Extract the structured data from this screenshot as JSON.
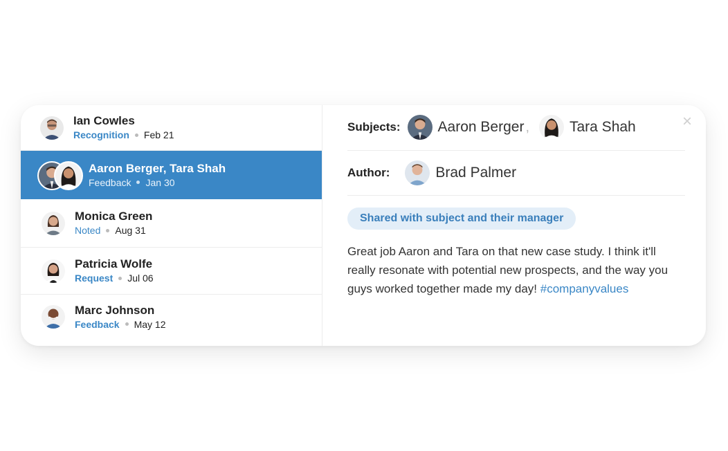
{
  "feed": {
    "items": [
      {
        "name": "Ian Cowles",
        "type": "Recognition",
        "date": "Feb 21"
      },
      {
        "name": "Aaron Berger, Tara Shah",
        "type": "Feedback",
        "date": "Jan 30"
      },
      {
        "name": "Monica Green",
        "type": "Noted",
        "date": "Aug 31"
      },
      {
        "name": "Patricia Wolfe",
        "type": "Request",
        "date": "Jul 06"
      },
      {
        "name": "Marc Johnson",
        "type": "Feedback",
        "date": "May 12"
      }
    ]
  },
  "detail": {
    "subjects_label": "Subjects:",
    "subjects": [
      "Aaron Berger",
      "Tara Shah"
    ],
    "subjects_separator": ",",
    "author_label": "Author:",
    "author": "Brad Palmer",
    "visibility_badge": "Shared with subject and their manager",
    "message": "Great job Aaron and Tara on that new case study. I think it'll really resonate with potential new prospects, and the way you guys worked together made my day!",
    "hashtag": "#companyvalues",
    "close_glyph": "×"
  },
  "colors": {
    "accent": "#3a87c6",
    "badge_bg": "#e3eef8"
  },
  "icons": [
    "avatar-ian-cowles",
    "avatar-aaron-berger",
    "avatar-tara-shah",
    "avatar-monica-green",
    "avatar-patricia-wolfe",
    "avatar-marc-johnson",
    "avatar-brad-palmer",
    "close-icon"
  ]
}
